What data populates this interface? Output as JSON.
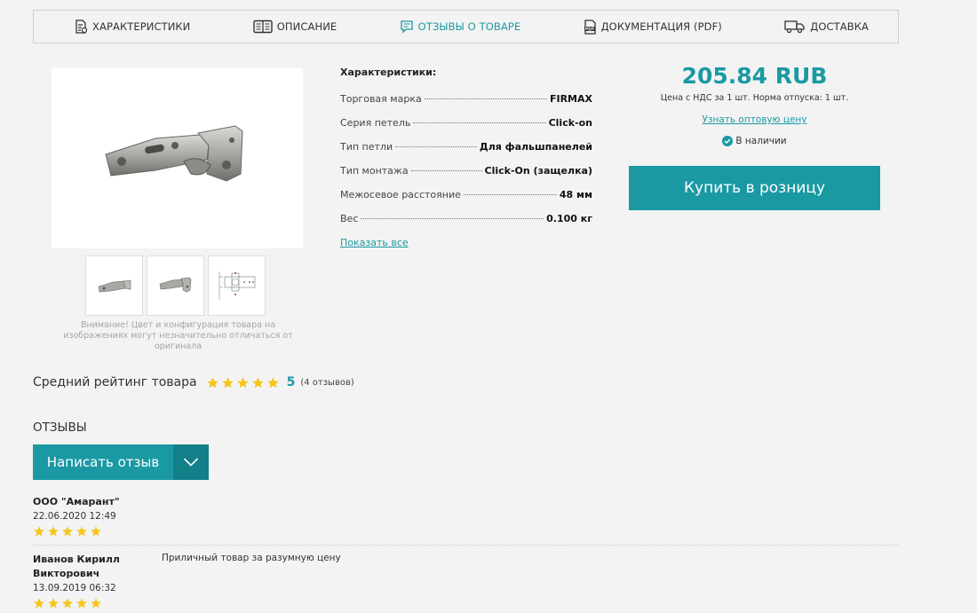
{
  "tabs": [
    {
      "label": "ХАРАКТЕРИСТИКИ",
      "icon": "spec-sheet-icon",
      "active": false
    },
    {
      "label": "ОПИСАНИЕ",
      "icon": "book-icon",
      "active": false
    },
    {
      "label": "ОТЗЫВЫ О ТОВАРЕ",
      "icon": "comment-icon",
      "active": true
    },
    {
      "label": "ДОКУМЕНТАЦИЯ (PDF)",
      "icon": "pdf-icon",
      "active": false
    },
    {
      "label": "ДОСТАВКА",
      "icon": "truck-icon",
      "active": false
    }
  ],
  "gallery": {
    "note": "Внимание! Цвет и конфигурация товара на изображениях могут незначительно отличаться от оригинала"
  },
  "specs": {
    "title": "Характеристики:",
    "rows": [
      {
        "label": "Торговая марка",
        "value": "FIRMAX"
      },
      {
        "label": "Серия петель",
        "value": "Click-on"
      },
      {
        "label": "Тип петли",
        "value": "Для фальшпанелей"
      },
      {
        "label": "Тип монтажа",
        "value": "Click-On (защелка)"
      },
      {
        "label": "Межосевое расстояние",
        "value": "48 мм"
      },
      {
        "label": "Вес",
        "value": "0.100 кг"
      }
    ],
    "show_all": "Показать все"
  },
  "price": {
    "value": "205.84 RUB",
    "note": "Цена с НДС за 1 шт. Норма отпуска: 1 шт.",
    "wholesale_link": "Узнать оптовую цену",
    "stock": "В наличии",
    "buy_label": "Купить в розницу"
  },
  "rating": {
    "label": "Средний рейтинг товара",
    "stars": 5,
    "value": "5",
    "count": "(4 отзывов)"
  },
  "reviews": {
    "heading": "ОТЗЫВЫ",
    "write_label": "Написать отзыв",
    "items": [
      {
        "author": "ООО \"Амарант\"",
        "date": "22.06.2020 12:49",
        "stars": 5,
        "text": ""
      },
      {
        "author": "Иванов Кирилл Викторович",
        "date": "13.09.2019 06:32",
        "stars": 5,
        "text": "Приличный товар за разумную цену"
      }
    ]
  },
  "colors": {
    "accent": "#1a99a3",
    "accent_dark": "#137f88",
    "star": "#f5c518"
  }
}
